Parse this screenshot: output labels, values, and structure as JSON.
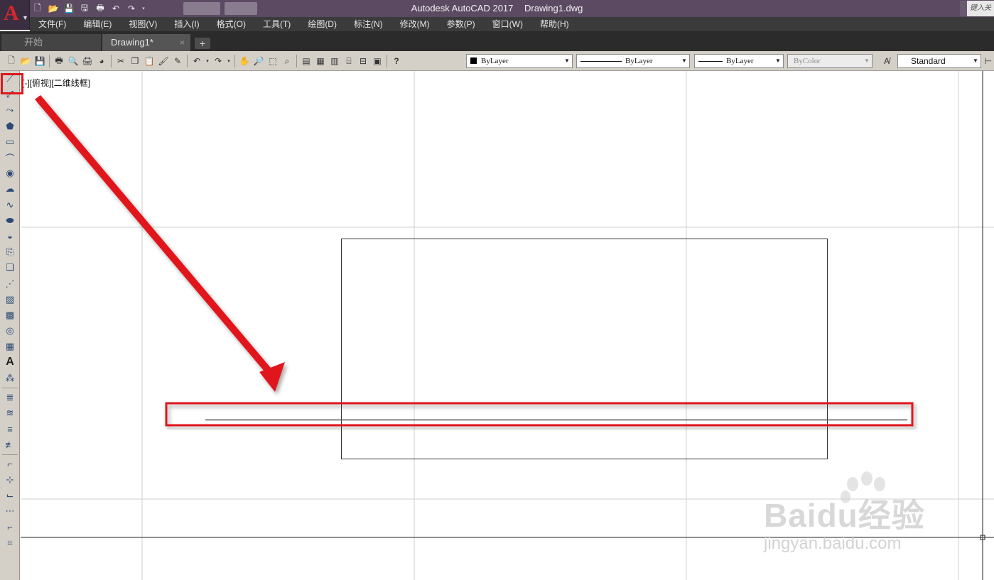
{
  "window": {
    "app_title": "Autodesk AutoCAD 2017",
    "file_name": "Drawing1.dwg",
    "search_placeholder": "键入关"
  },
  "app_button": {
    "letter": "A"
  },
  "quick_access": [
    {
      "name": "new-icon",
      "glyph": "🗋"
    },
    {
      "name": "open-icon",
      "glyph": "📂"
    },
    {
      "name": "save-icon",
      "glyph": "💾"
    },
    {
      "name": "saveas-icon",
      "glyph": "🖫"
    },
    {
      "name": "print-icon",
      "glyph": "🖶"
    },
    {
      "name": "undo-icon",
      "glyph": "↶"
    },
    {
      "name": "redo-icon",
      "glyph": "↷"
    },
    {
      "name": "customize-icon",
      "glyph": "▾"
    }
  ],
  "menu": [
    "文件(F)",
    "编辑(E)",
    "视图(V)",
    "插入(I)",
    "格式(O)",
    "工具(T)",
    "绘图(D)",
    "标注(N)",
    "修改(M)",
    "参数(P)",
    "窗口(W)",
    "帮助(H)"
  ],
  "tabs": {
    "start": "开始",
    "drawing": "Drawing1*",
    "close": "×",
    "add": "+"
  },
  "toolbar_combos": {
    "color": "ByLayer",
    "linetype": "ByLayer",
    "lineweight": "ByLayer",
    "plotstyle": "ByColor",
    "textstyle": "Standard"
  },
  "viewport_label": "[-][俯视][二维线框]",
  "left_tools": [
    "line-icon",
    "construction-line-icon",
    "polyline-icon",
    "polygon-icon",
    "rectangle-icon",
    "arc-icon",
    "circle-icon",
    "revision-cloud-icon",
    "spline-icon",
    "ellipse-icon",
    "ellipse-arc-icon",
    "insert-block-icon",
    "make-block-icon",
    "point-icon",
    "hatch-icon",
    "gradient-icon",
    "region-icon",
    "table-icon",
    "multiline-text-icon",
    "add-selected-icon",
    "layer-1-icon",
    "layer-2-icon",
    "layer-3-icon",
    "layer-4-icon",
    "edit-1-icon",
    "edit-2-icon",
    "edit-3-icon",
    "edit-4-icon",
    "edit-5-icon",
    "edit-6-icon"
  ],
  "left_tool_text": "A",
  "watermark": {
    "brand": "Baidu经验",
    "url": "jingyan.baidu.com"
  },
  "colors": {
    "title_bar": "#5b4a62",
    "menu_bar": "#3b3b3b",
    "toolbar": "#d4d0c8",
    "highlight_red": "#e0161b"
  }
}
